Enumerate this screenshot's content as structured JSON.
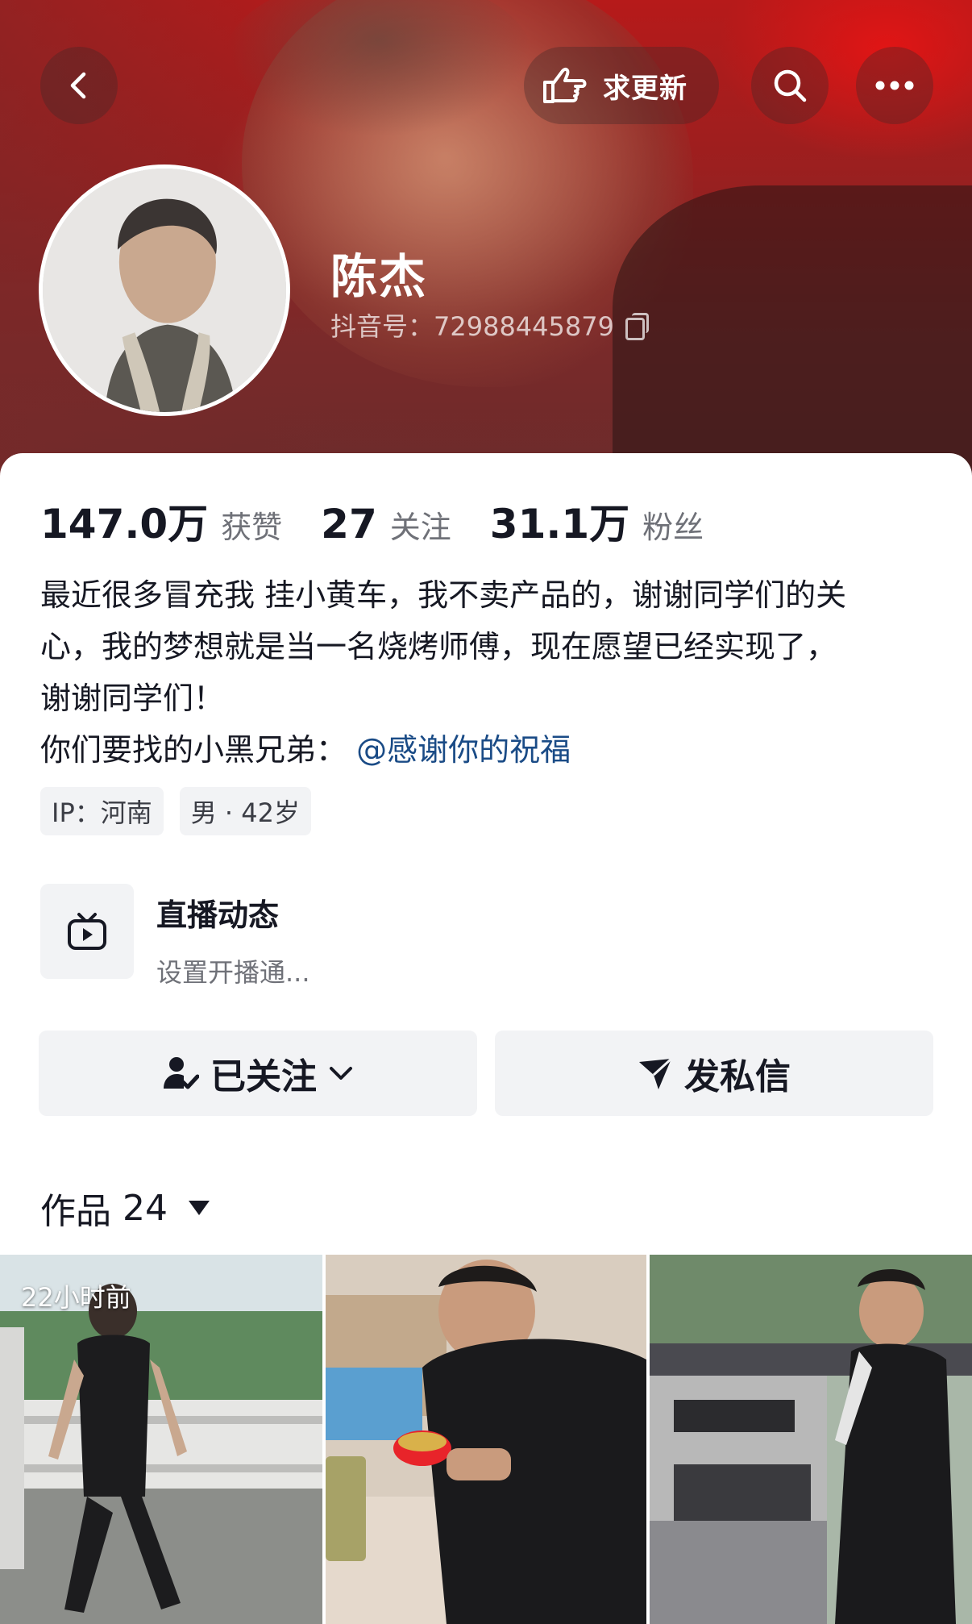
{
  "header": {
    "update_label": "求更新",
    "icons": {
      "back": "chevron-left-icon",
      "update": "hand-point-icon",
      "search": "search-icon",
      "more": "more-dots-icon"
    }
  },
  "profile": {
    "name": "陈杰",
    "douyin_id": "抖音号：72988445879",
    "avatar_icon": "avatar"
  },
  "stats": [
    {
      "value": "147.0万",
      "label": "获赞"
    },
    {
      "value": "27",
      "label": "关注"
    },
    {
      "value": "31.1万",
      "label": "粉丝"
    }
  ],
  "bio": {
    "line1": "最近很多冒充我 挂小黄车，我不卖产品的，谢谢同学们的关",
    "line2": "心，我的梦想就是当一名烧烤师傅，现在愿望已经实现了，",
    "line3": "谢谢同学们！",
    "line4_prefix": "你们要找的小黑兄弟：",
    "mention": "@感谢你的祝福"
  },
  "tags": [
    "IP：河南",
    "男 · 42岁"
  ],
  "live": {
    "title": "直播动态",
    "subtitle": "设置开播通...",
    "icon": "tv-icon"
  },
  "actions": {
    "follow_label": "已关注",
    "message_label": "发私信"
  },
  "works": {
    "label": "作品",
    "count": "24"
  },
  "thumbnails": [
    {
      "time": "22小时前"
    },
    {
      "time": ""
    },
    {
      "time": ""
    }
  ]
}
